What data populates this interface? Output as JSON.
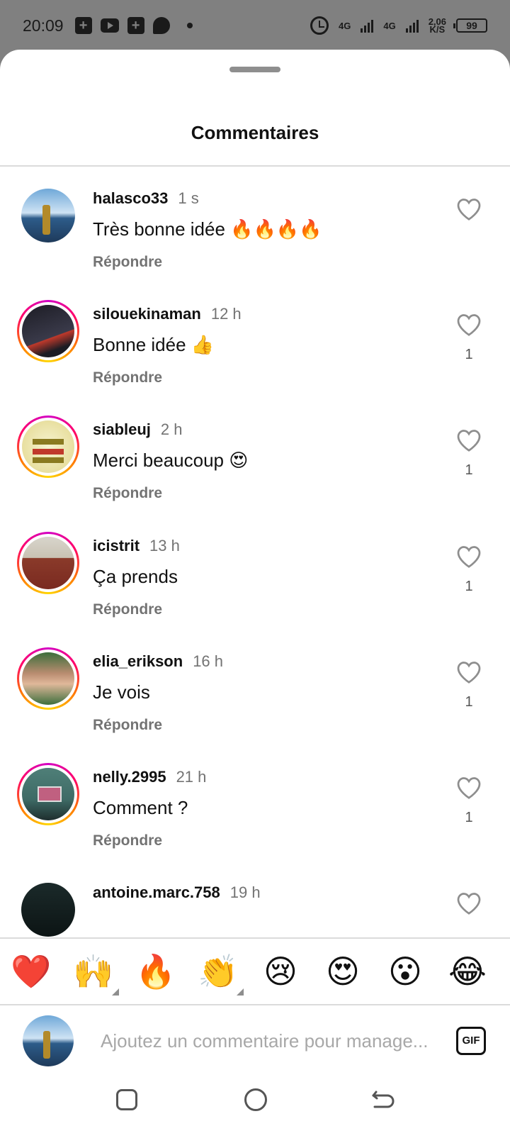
{
  "status_bar": {
    "time": "20:09",
    "network_1": "4G",
    "network_2": "4G",
    "speed_value": "2,06",
    "speed_unit": "K/S",
    "battery": "99"
  },
  "sheet": {
    "title": "Commentaires"
  },
  "comments": [
    {
      "username": "halasco33",
      "time": "1 s",
      "text": "Très bonne idée 🔥🔥🔥🔥",
      "reply_label": "Répondre",
      "likes": "",
      "story_ring": false
    },
    {
      "username": "silouekinaman",
      "time": "12 h",
      "text": "Bonne idée 👍",
      "reply_label": "Répondre",
      "likes": "1",
      "story_ring": true
    },
    {
      "username": "siableuj",
      "time": "2 h",
      "text": "Merci beaucoup 😍",
      "reply_label": "Répondre",
      "likes": "1",
      "story_ring": true
    },
    {
      "username": "icistrit",
      "time": "13 h",
      "text": "Ça prends",
      "reply_label": "Répondre",
      "likes": "1",
      "story_ring": true
    },
    {
      "username": "elia_erikson",
      "time": "16 h",
      "text": "Je vois",
      "reply_label": "Répondre",
      "likes": "1",
      "story_ring": true
    },
    {
      "username": "nelly.2995",
      "time": "21 h",
      "text": "Comment ?",
      "reply_label": "Répondre",
      "likes": "1",
      "story_ring": true
    },
    {
      "username": "antoine.marc.758",
      "time": "19 h",
      "text": "",
      "reply_label": "",
      "likes": "",
      "story_ring": false
    }
  ],
  "emoji_bar": {
    "emojis": [
      "❤️",
      "🙌",
      "🔥",
      "👏",
      "😢",
      "😍",
      "😮",
      "😂"
    ]
  },
  "input": {
    "placeholder": "Ajoutez un commentaire pour manage...",
    "gif_label": "GIF"
  },
  "icons": {
    "like": "heart-outline-icon",
    "recent_apps": "square-icon",
    "home": "circle-icon",
    "back": "back-arrow-icon"
  }
}
